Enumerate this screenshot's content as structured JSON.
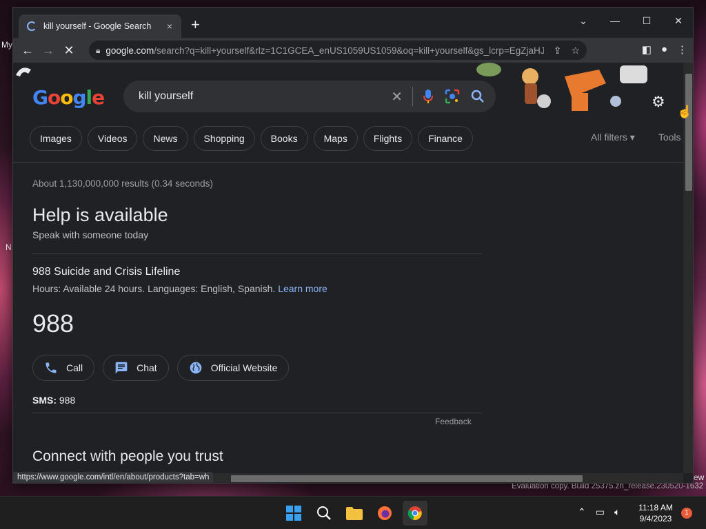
{
  "desktop": {
    "labels": [
      "My",
      "N"
    ],
    "watermark": "Evaluation copy. Build 25375.zn_release.230520-1632",
    "edge_fragment": "ew"
  },
  "browser": {
    "tab": {
      "title": "kill yourself - Google Search",
      "close": "×"
    },
    "new_tab": "+",
    "url_host": "google.com",
    "url_rest": "/search?q=kill+yourself&rlz=1C1GCEA_enUS1059US1059&oq=kill+yourself&gs_lcrp=EgZjaHJ...",
    "status_url": "https://www.google.com/intl/en/about/products?tab=wh"
  },
  "search": {
    "query": "kill yourself",
    "chips": [
      "Images",
      "Videos",
      "News",
      "Shopping",
      "Books",
      "Maps",
      "Flights",
      "Finance"
    ],
    "all_filters": "All filters",
    "tools": "Tools",
    "results_stats": "About 1,130,000,000 results (0.34 seconds)"
  },
  "help_panel": {
    "title": "Help is available",
    "subtitle": "Speak with someone today",
    "org_name": "988 Suicide and Crisis Lifeline",
    "hours": "Hours: Available 24 hours. Languages: English, Spanish.",
    "learn_more": "Learn more",
    "number": "988",
    "actions": {
      "call": "Call",
      "chat": "Chat",
      "website": "Official Website"
    },
    "sms_label": "SMS:",
    "sms_value": "988",
    "feedback": "Feedback",
    "connect_title": "Connect with people you trust"
  },
  "taskbar": {
    "time": "11:18 AM",
    "date": "9/4/2023",
    "notifications": "1"
  },
  "colors": {
    "page_bg": "#202124",
    "link": "#8ab4f8",
    "text": "#e8eaed",
    "muted": "#9aa0a6"
  }
}
